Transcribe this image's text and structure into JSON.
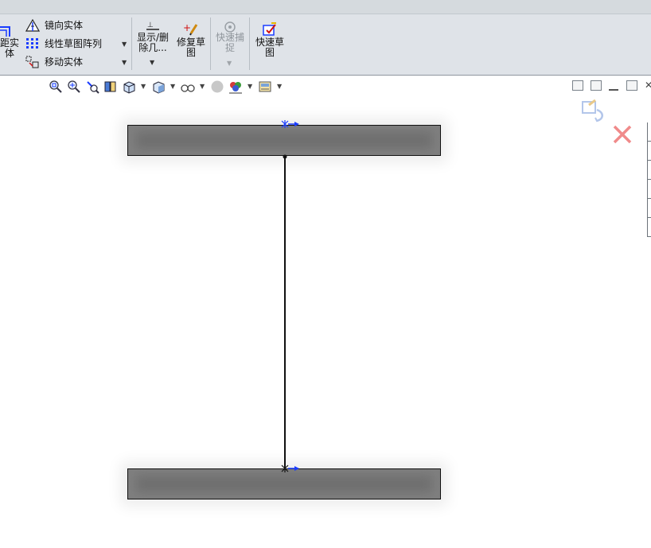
{
  "ribbon": {
    "partial_left_label_1": "距实",
    "partial_left_label_2": "体",
    "mirror_label": "镜向实体",
    "linear_pattern_label": "线性草图阵列",
    "move_label": "移动实体",
    "show_delete_label_1": "显示/删",
    "show_delete_label_2": "除几...",
    "repair_label_1": "修复草",
    "repair_label_2": "图",
    "quick_snap_label_1": "快速捕",
    "quick_snap_label_2": "捉",
    "quick_sketch_label_1": "快速草",
    "quick_sketch_label_2": "图"
  },
  "view_toolbar": {
    "icons": [
      "zoom-to-fit-icon",
      "zoom-area-icon",
      "previous-view-icon",
      "section-view-icon",
      "view-orientation-icon",
      "display-style-icon",
      "hide-show-items-icon",
      "edit-appearance-icon",
      "apply-scene-icon",
      "view-settings-icon"
    ]
  },
  "colors": {
    "accent": "#1a3cff",
    "flange": "#7f7f7f",
    "ribbon_bg": "#dfe3e8",
    "confirm_red": "#e23a3a"
  }
}
